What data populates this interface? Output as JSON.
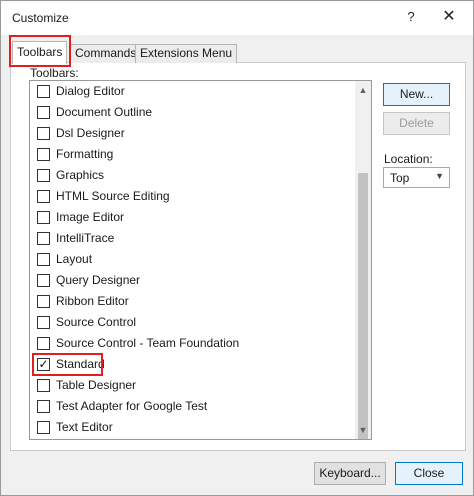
{
  "window": {
    "title": "Customize",
    "help_glyph": "?",
    "close_glyph": "✕"
  },
  "tabs": [
    {
      "label": "Toolbars",
      "active": true
    },
    {
      "label": "Commands",
      "active": false
    },
    {
      "label": "Extensions Menu",
      "active": false
    }
  ],
  "toolbars_panel": {
    "list_label": "Toolbars:",
    "items": [
      {
        "label": "Dialog Editor",
        "checked": false
      },
      {
        "label": "Document Outline",
        "checked": false
      },
      {
        "label": "Dsl Designer",
        "checked": false
      },
      {
        "label": "Formatting",
        "checked": false
      },
      {
        "label": "Graphics",
        "checked": false
      },
      {
        "label": "HTML Source Editing",
        "checked": false
      },
      {
        "label": "Image Editor",
        "checked": false
      },
      {
        "label": "IntelliTrace",
        "checked": false
      },
      {
        "label": "Layout",
        "checked": false
      },
      {
        "label": "Query Designer",
        "checked": false
      },
      {
        "label": "Ribbon Editor",
        "checked": false
      },
      {
        "label": "Source Control",
        "checked": false
      },
      {
        "label": "Source Control - Team Foundation",
        "checked": false
      },
      {
        "label": "Standard",
        "checked": true
      },
      {
        "label": "Table Designer",
        "checked": false
      },
      {
        "label": "Test Adapter for Google Test",
        "checked": false
      },
      {
        "label": "Text Editor",
        "checked": false
      }
    ],
    "check_glyph": "✓",
    "new_button": "New...",
    "delete_button": "Delete",
    "location_label": "Location:",
    "location_value": "Top"
  },
  "footer": {
    "keyboard_button": "Keyboard...",
    "close_button": "Close"
  },
  "colors": {
    "highlight_red": "#e02020",
    "accent_blue": "#0078d4"
  }
}
